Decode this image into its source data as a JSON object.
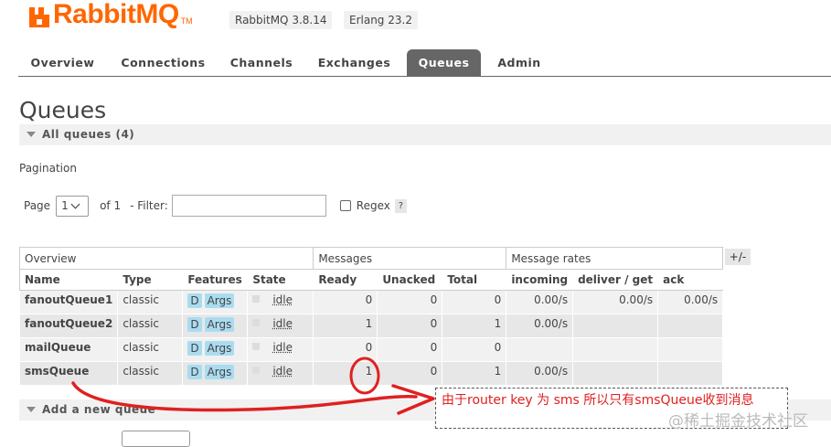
{
  "header": {
    "logo_text": "RabbitMQ",
    "logo_tm": "TM",
    "version_rabbit": "RabbitMQ 3.8.14",
    "version_erlang": "Erlang 23.2"
  },
  "tabs": [
    {
      "label": "Overview"
    },
    {
      "label": "Connections"
    },
    {
      "label": "Channels"
    },
    {
      "label": "Exchanges"
    },
    {
      "label": "Queues",
      "active": true
    },
    {
      "label": "Admin"
    }
  ],
  "page_title": "Queues",
  "all_queues_label": "All queues (4)",
  "pagination": {
    "heading": "Pagination",
    "page_label": "Page",
    "page_value": "1",
    "of_label": "of 1",
    "filter_label": "- Filter:",
    "filter_value": "",
    "regex_label": "Regex",
    "help": "?"
  },
  "table": {
    "groups": [
      "Overview",
      "Messages",
      "Message rates"
    ],
    "plus_minus": "+/-",
    "columns": [
      "Name",
      "Type",
      "Features",
      "State",
      "Ready",
      "Unacked",
      "Total",
      "incoming",
      "deliver / get",
      "ack"
    ],
    "rows": [
      {
        "name": "fanoutQueue1",
        "type": "classic",
        "features": [
          "D",
          "Args"
        ],
        "state": "idle",
        "ready": "0",
        "unacked": "0",
        "total": "0",
        "incoming": "0.00/s",
        "deliver": "0.00/s",
        "ack": "0.00/s"
      },
      {
        "name": "fanoutQueue2",
        "type": "classic",
        "features": [
          "D",
          "Args"
        ],
        "state": "idle",
        "ready": "1",
        "unacked": "0",
        "total": "1",
        "incoming": "0.00/s",
        "deliver": "",
        "ack": ""
      },
      {
        "name": "mailQueue",
        "type": "classic",
        "features": [
          "D",
          "Args"
        ],
        "state": "idle",
        "ready": "0",
        "unacked": "0",
        "total": "0",
        "incoming": "",
        "deliver": "",
        "ack": ""
      },
      {
        "name": "smsQueue",
        "type": "classic",
        "features": [
          "D",
          "Args"
        ],
        "state": "idle",
        "ready": "1",
        "unacked": "0",
        "total": "1",
        "incoming": "0.00/s",
        "deliver": "",
        "ack": ""
      }
    ]
  },
  "add_queue_label": "Add a new queue",
  "annotation": {
    "text": "由于router key 为 sms 所以只有smsQueue收到消息",
    "color": "#e02020"
  },
  "watermark": "@稀土掘金技术社区",
  "colors": {
    "brand": "#ff6600",
    "tab_active": "#666666",
    "feature_badge": "#aadcf0"
  }
}
